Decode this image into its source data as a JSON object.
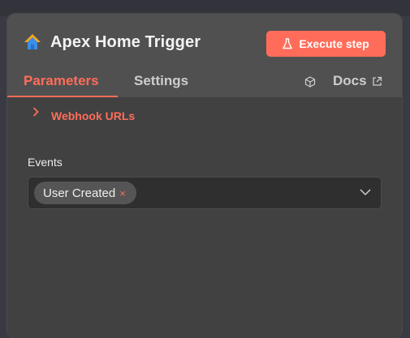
{
  "node": {
    "title": "Apex Home Trigger",
    "logo_icon": "apex-home-logo",
    "execute_button": {
      "label": "Execute step",
      "icon": "flask-icon"
    },
    "accent_color": "#ff6d5a"
  },
  "tabs": [
    {
      "label": "Parameters",
      "active": true
    },
    {
      "label": "Settings",
      "active": false
    }
  ],
  "docs": {
    "label": "Docs",
    "icons": [
      "cube-icon",
      "external-link-icon"
    ]
  },
  "webhook": {
    "label": "Webhook URLs",
    "expanded": false
  },
  "events": {
    "label": "Events",
    "selected": [
      {
        "label": "User Created",
        "remove": "×"
      }
    ]
  }
}
